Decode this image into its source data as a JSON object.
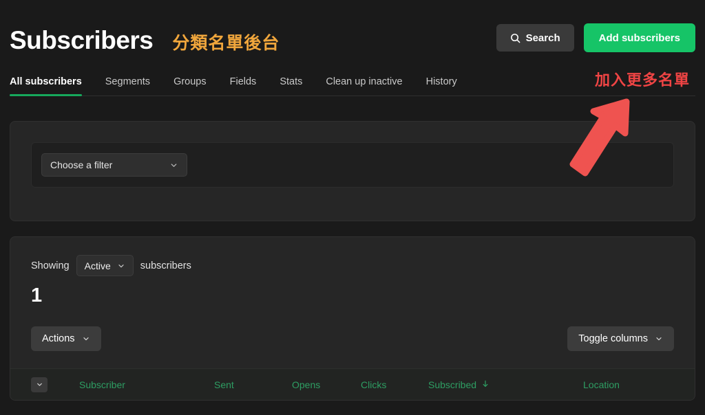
{
  "header": {
    "title": "Subscribers",
    "title_annotation": "分類名單後台",
    "search_label": "Search",
    "search_icon": "search-icon",
    "add_label": "Add subscribers",
    "tabs_annotation": "加入更多名單",
    "accent_green": "#16c467",
    "annotation_orange": "#f0a63c",
    "annotation_red": "#ef4444"
  },
  "tabs": [
    {
      "label": "All subscribers",
      "active": true
    },
    {
      "label": "Segments",
      "active": false
    },
    {
      "label": "Groups",
      "active": false
    },
    {
      "label": "Fields",
      "active": false
    },
    {
      "label": "Stats",
      "active": false
    },
    {
      "label": "Clean up inactive",
      "active": false
    },
    {
      "label": "History",
      "active": false
    }
  ],
  "filter_card": {
    "filter_select_value": "Choose a filter",
    "chevron_icon": "chevron-down-icon"
  },
  "list_card": {
    "showing_prefix": "Showing",
    "status_value": "Active",
    "showing_suffix": "subscribers",
    "count": "1",
    "actions_label": "Actions",
    "toggle_columns_label": "Toggle columns"
  },
  "table": {
    "select_all_icon": "chevron-down-icon",
    "columns": [
      {
        "label": "Subscriber",
        "sorted": false
      },
      {
        "label": "Sent",
        "sorted": false
      },
      {
        "label": "Opens",
        "sorted": false
      },
      {
        "label": "Clicks",
        "sorted": false
      },
      {
        "label": "Subscribed",
        "sorted": true,
        "sort_icon": "arrow-down-icon"
      },
      {
        "label": "Location",
        "sorted": false
      }
    ],
    "header_color": "#2e9e63"
  },
  "annotations": {
    "arrow": "red-arrow-up-right"
  }
}
